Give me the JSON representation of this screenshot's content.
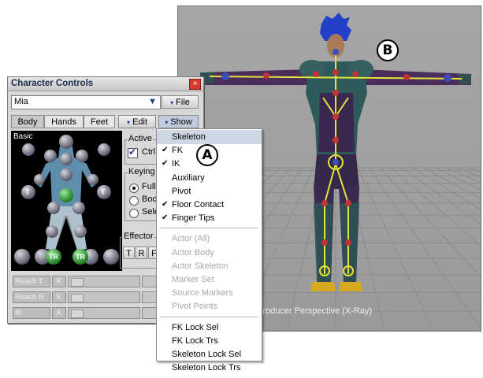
{
  "viewport": {
    "label": "Producer Perspective (X-Ray)",
    "callout": "B"
  },
  "window": {
    "title": "Character Controls",
    "close_glyph": "×",
    "character": "Mia",
    "file_label": "File",
    "tabs": [
      "Body",
      "Hands",
      "Feet"
    ],
    "edit_label": "Edit",
    "show_label": "Show",
    "panel_label": "Basic",
    "dropdown_glyph": "▼",
    "active_label": "Active",
    "ctrl_label": "Ctrl",
    "keying_label": "Keying M",
    "keying_options": [
      "Full I",
      "Body",
      "Sele"
    ],
    "effector_label": "Effector",
    "effector_buttons": [
      "T",
      "R",
      "F"
    ],
    "reach_rows": [
      {
        "label": "Reach T",
        "k": "K",
        "value": "0."
      },
      {
        "label": "Reach R",
        "k": "K",
        "value": "0."
      },
      {
        "label": "IK",
        "k": "K",
        "value": "0."
      }
    ],
    "markers": {
      "t": "T",
      "tr": "TR"
    }
  },
  "menu": {
    "callout": "A",
    "items": [
      {
        "label": "Skeleton",
        "checked": false,
        "disabled": false,
        "highlight": true
      },
      {
        "label": "FK",
        "checked": true,
        "disabled": false
      },
      {
        "label": "IK",
        "checked": true,
        "disabled": false
      },
      {
        "label": "Auxiliary",
        "checked": false,
        "disabled": false
      },
      {
        "label": "Pivot",
        "checked": false,
        "disabled": false
      },
      {
        "label": "Floor Contact",
        "checked": true,
        "disabled": false
      },
      {
        "label": "Finger Tips",
        "checked": true,
        "disabled": false
      },
      {
        "sep": true
      },
      {
        "label": "Actor (All)",
        "checked": false,
        "disabled": true
      },
      {
        "label": "Actor Body",
        "checked": false,
        "disabled": true
      },
      {
        "label": "Actor Skeleton",
        "checked": false,
        "disabled": true
      },
      {
        "label": "Marker Set",
        "checked": false,
        "disabled": true
      },
      {
        "label": "Source Markers",
        "checked": false,
        "disabled": true
      },
      {
        "label": "Pivot Points",
        "checked": false,
        "disabled": true
      },
      {
        "sep": true
      },
      {
        "label": "FK Lock Sel",
        "checked": false,
        "disabled": false
      },
      {
        "label": "FK Lock Trs",
        "checked": false,
        "disabled": false
      },
      {
        "label": "Skeleton Lock Sel",
        "checked": false,
        "disabled": false
      },
      {
        "label": "Skeleton Lock Trs",
        "checked": false,
        "disabled": false
      }
    ]
  },
  "colors": {
    "viewport_bg": "#a3a3a3",
    "skeleton": "#e6e23a",
    "fk_node": "#c03535",
    "ik_node": "#3a4fb8",
    "suit": "#2e5a5a"
  }
}
